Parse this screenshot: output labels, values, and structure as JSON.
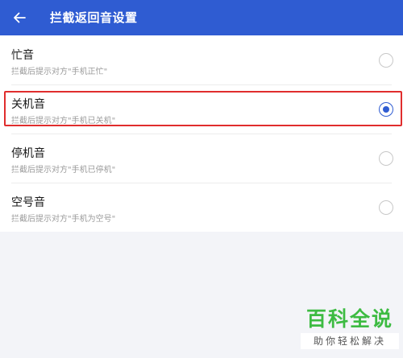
{
  "header": {
    "title": "拦截返回音设置"
  },
  "options": [
    {
      "label": "忙音",
      "description": "拦截后提示对方\"手机正忙\"",
      "selected": false
    },
    {
      "label": "关机音",
      "description": "拦截后提示对方\"手机已关机\"",
      "selected": true
    },
    {
      "label": "停机音",
      "description": "拦截后提示对方\"手机已停机\"",
      "selected": false
    },
    {
      "label": "空号音",
      "description": "拦截后提示对方\"手机为空号\"",
      "selected": false
    }
  ],
  "watermark": {
    "line1": "百科全说",
    "line2": "助你轻松解决"
  },
  "colors": {
    "app_bar": "#2f5cd2",
    "accent": "#2f5cd2",
    "highlight_frame": "#e02d2d",
    "watermark_green": "#3dbb42"
  }
}
